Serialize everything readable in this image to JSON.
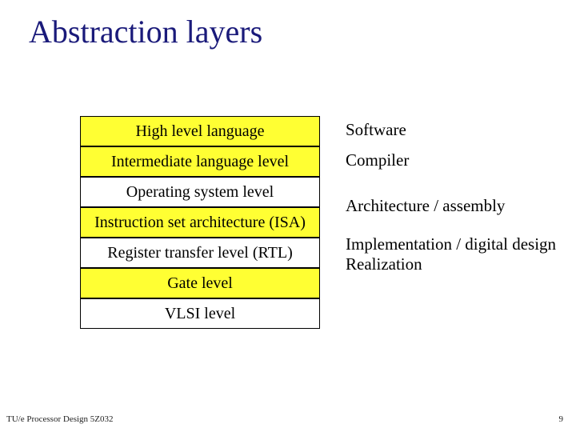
{
  "title": "Abstraction layers",
  "levels": [
    {
      "name": "High level language",
      "highlight": true
    },
    {
      "name": "Intermediate language level",
      "highlight": true
    },
    {
      "name": "Operating system level",
      "highlight": false
    },
    {
      "name": "Instruction set architecture (ISA)",
      "highlight": true
    },
    {
      "name": "Register transfer level (RTL)",
      "highlight": false
    },
    {
      "name": "Gate level",
      "highlight": true
    },
    {
      "name": "VLSI level",
      "highlight": false
    }
  ],
  "annotations": {
    "software": "Software",
    "compiler": "Compiler",
    "architecture": "Architecture / assembly",
    "implementation_l1": "Implementation / digital design",
    "implementation_l2": "Realization"
  },
  "footer": "TU/e   Processor Design 5Z032",
  "page_number": "9"
}
